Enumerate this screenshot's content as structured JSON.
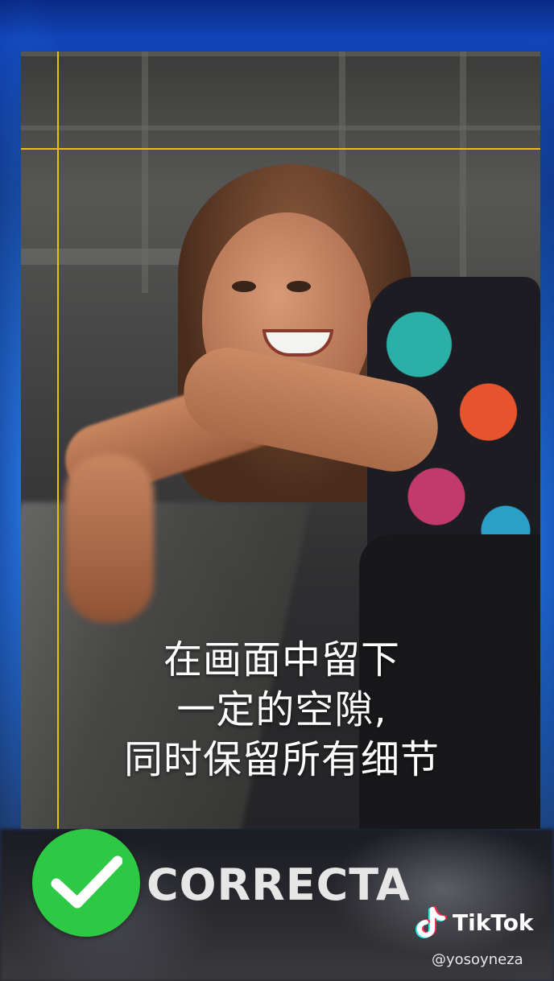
{
  "caption": {
    "line1": "在画面中留下",
    "line2": "一定的空隙,",
    "line3": "同时保留所有细节"
  },
  "verdict": {
    "label": "CORRECTA",
    "icon": "check-circle-icon",
    "color": "#2ec944"
  },
  "guides": {
    "color": "#e7c300"
  },
  "watermark": {
    "brand": "TikTok",
    "handle": "@yosoyneza",
    "icon": "tiktok-note-icon"
  }
}
